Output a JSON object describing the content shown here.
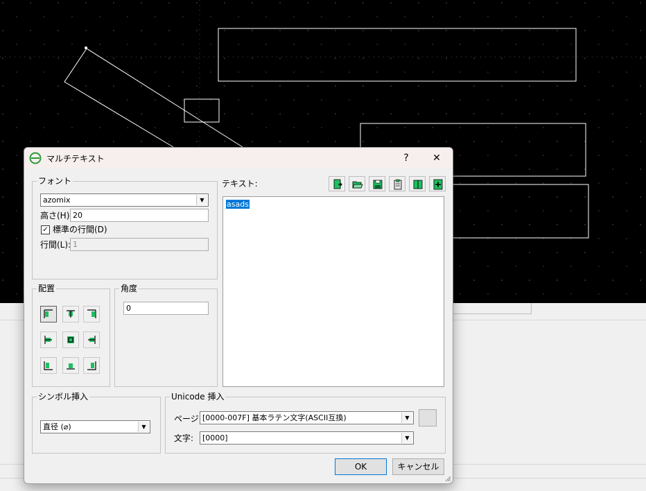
{
  "dialog": {
    "title": "マルチテキスト",
    "help_label": "?",
    "close_label": "✕",
    "font_group": {
      "title": "フォント",
      "font_name": "azomix",
      "height_label": "高さ(H):",
      "height_value": "20",
      "standard_spacing_label": "標準の行間(D)",
      "standard_spacing_checked": true,
      "line_spacing_label": "行間(L):",
      "line_spacing_value": "1"
    },
    "alignment_group": {
      "title": "配置",
      "selected": "top-left"
    },
    "angle_group": {
      "title": "角度",
      "value": "0"
    },
    "text_group": {
      "label": "テキスト:",
      "content": "asads"
    },
    "toolbar": {
      "icons": [
        "new-page-icon",
        "open-folder-icon",
        "save-icon",
        "clipboard-icon",
        "book-icon",
        "add-page-icon"
      ]
    },
    "symbol_group": {
      "title": "シンボル挿入",
      "selected": "直径 (⌀)"
    },
    "unicode_group": {
      "title": "Unicode 挿入",
      "page_label": "ページ:",
      "page_value": "[0000-007F] 基本ラテン文字(ASCII互換)",
      "char_label": "文字:",
      "char_value": "[0000]"
    },
    "buttons": {
      "ok": "OK",
      "cancel": "キャンセル"
    }
  },
  "colors": {
    "canvas_bg": "#000000",
    "canvas_lines": "#ffffff",
    "button_icon_green": "#20c060",
    "selection": "#0078d7"
  }
}
